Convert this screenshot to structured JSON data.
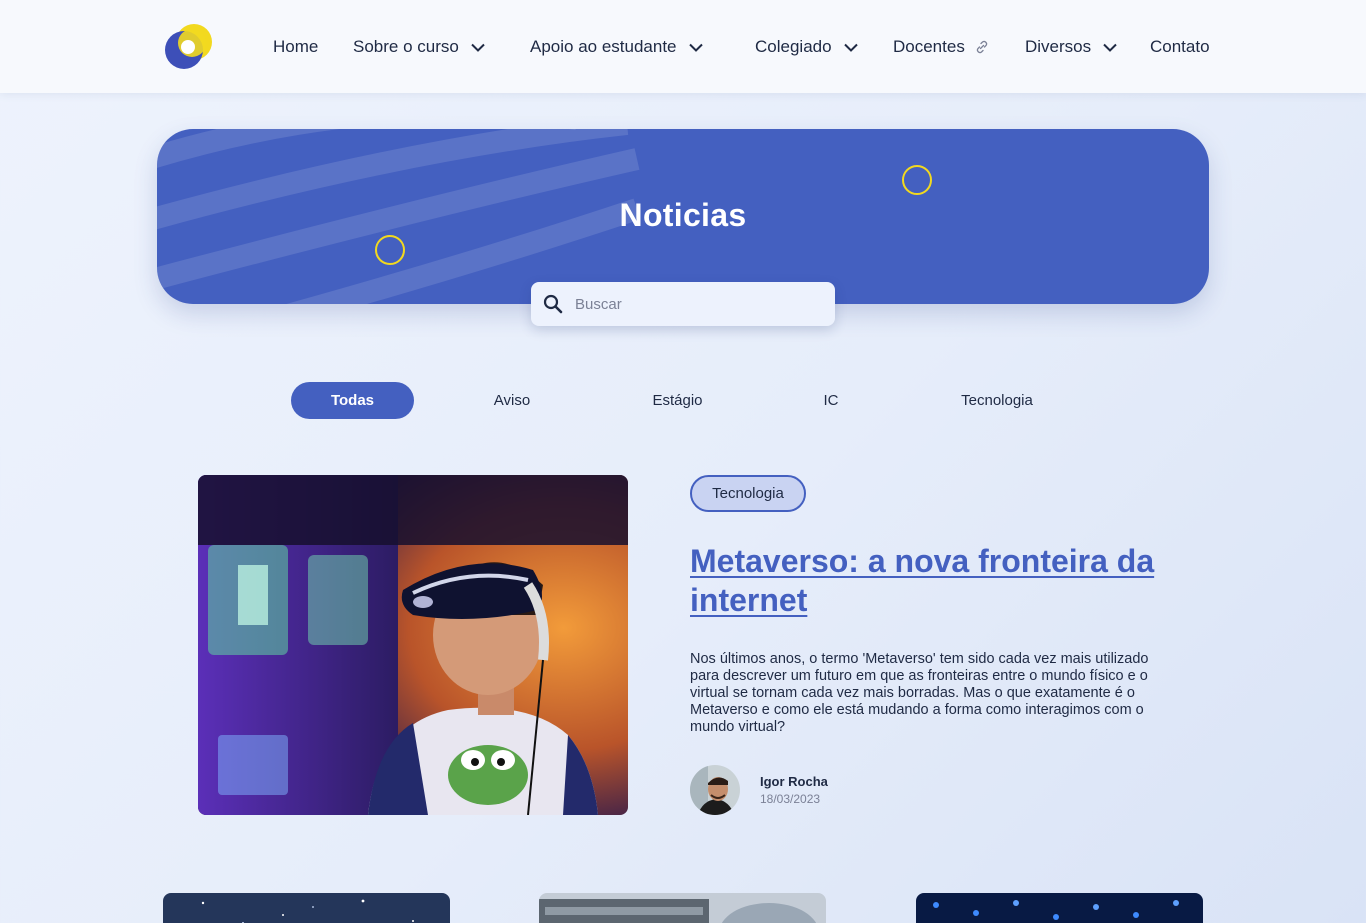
{
  "nav": {
    "items": [
      {
        "label": "Home",
        "has_dropdown": false,
        "has_link_icon": false
      },
      {
        "label": "Sobre o curso",
        "has_dropdown": true,
        "has_link_icon": false
      },
      {
        "label": "Apoio ao estudante",
        "has_dropdown": true,
        "has_link_icon": false
      },
      {
        "label": "Colegiado",
        "has_dropdown": true,
        "has_link_icon": false
      },
      {
        "label": "Docentes",
        "has_dropdown": false,
        "has_link_icon": true
      },
      {
        "label": "Diversos",
        "has_dropdown": true,
        "has_link_icon": false
      },
      {
        "label": "Contato",
        "has_dropdown": false,
        "has_link_icon": false
      }
    ]
  },
  "hero": {
    "title": "Noticias",
    "search_placeholder": "Buscar",
    "search_value": ""
  },
  "filters": {
    "tabs": [
      "Todas",
      "Aviso",
      "Estágio",
      "IC",
      "Tecnologia"
    ],
    "active": "Todas"
  },
  "featured": {
    "category": "Tecnologia",
    "title": "Metaverso: a nova fronteira da internet",
    "excerpt": "Nos últimos anos, o termo 'Metaverso' tem sido cada vez mais utilizado para descrever um futuro em que as fronteiras entre o mundo físico e o virtual se tornam cada vez mais borradas. Mas o que exatamente é o Metaverso e como ele está mudando a forma como interagimos com o mundo virtual?",
    "author": {
      "name": "Igor Rocha",
      "date": "18/03/2023"
    }
  },
  "colors": {
    "brand_blue": "#4460c0",
    "accent_yellow": "#f2d91f",
    "text_dark": "#1f2a44",
    "text_muted": "#7b8196"
  },
  "icons": {
    "logo": "logo-icon",
    "dropdown": "chevron-down-icon",
    "external": "link-icon",
    "search": "search-icon"
  }
}
